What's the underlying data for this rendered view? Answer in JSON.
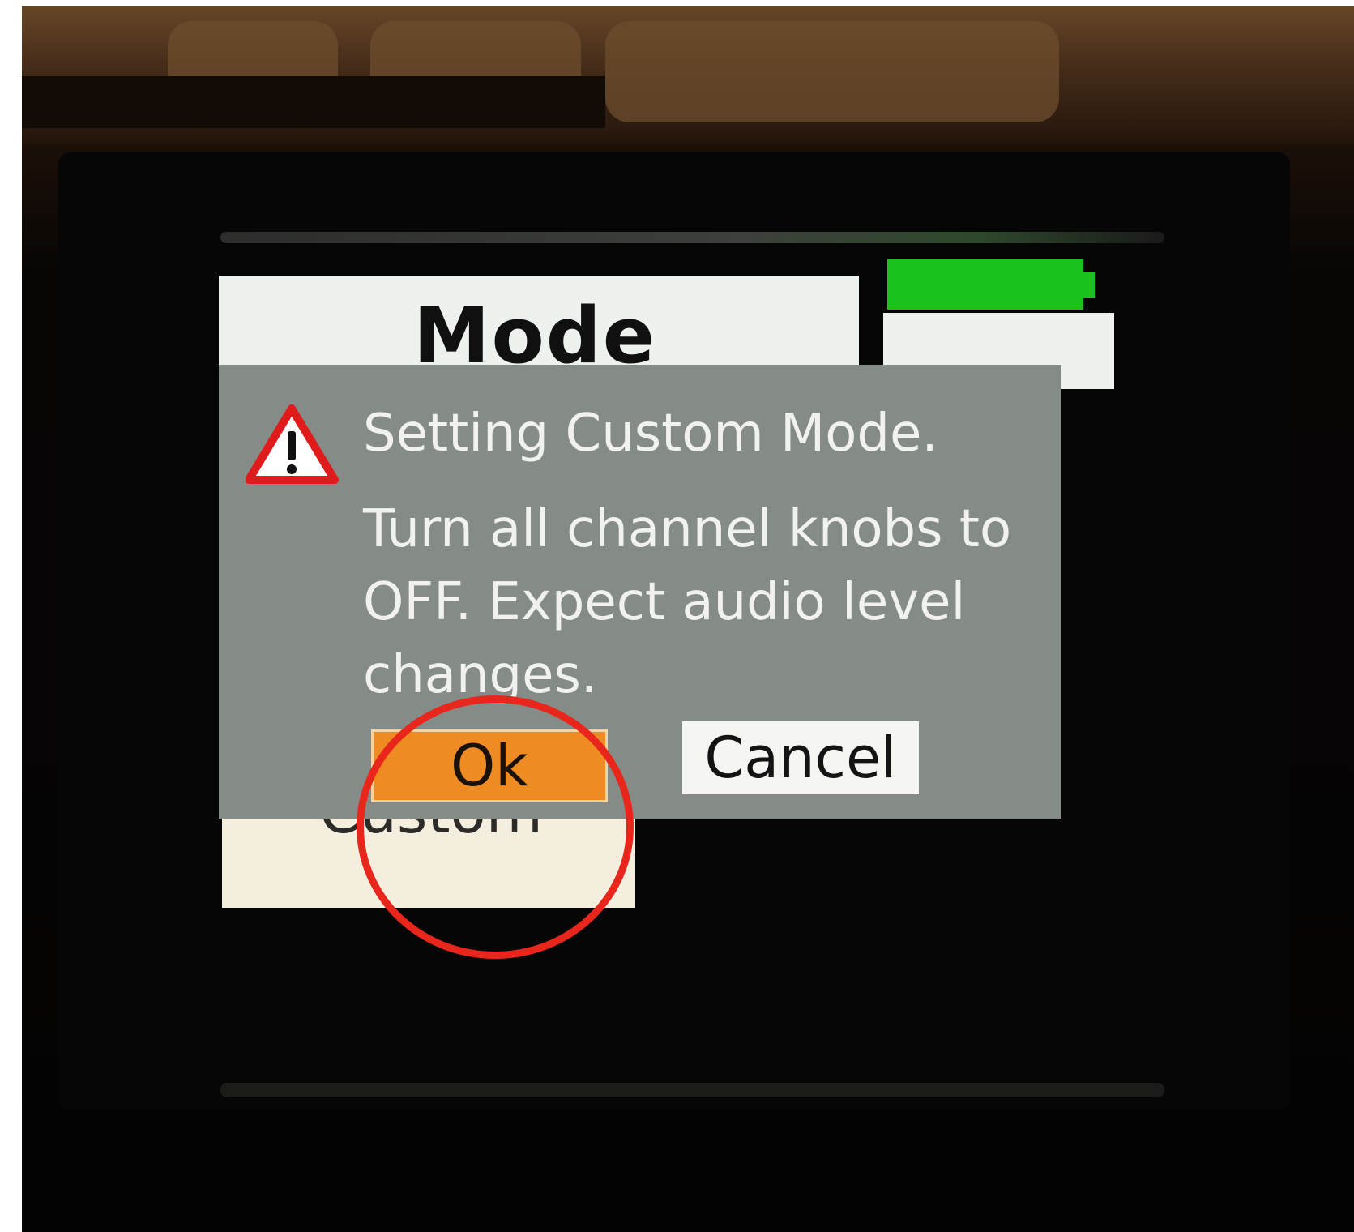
{
  "device": {
    "header_title": "Mode",
    "battery_color": "#19c21c",
    "header_right_icon": "home-icon"
  },
  "dialog": {
    "icon": "warning-icon",
    "title": "Setting Custom Mode.",
    "body": "Turn all channel knobs to OFF. Expect audio level changes.",
    "ok_label": "Ok",
    "cancel_label": "Cancel",
    "ok_color": "#ee8b22",
    "background_color": "#858c87"
  },
  "list": {
    "selected_item_label": "Custom"
  },
  "annotation": {
    "type": "circle",
    "color": "#e8261c",
    "target": "ok-button"
  }
}
